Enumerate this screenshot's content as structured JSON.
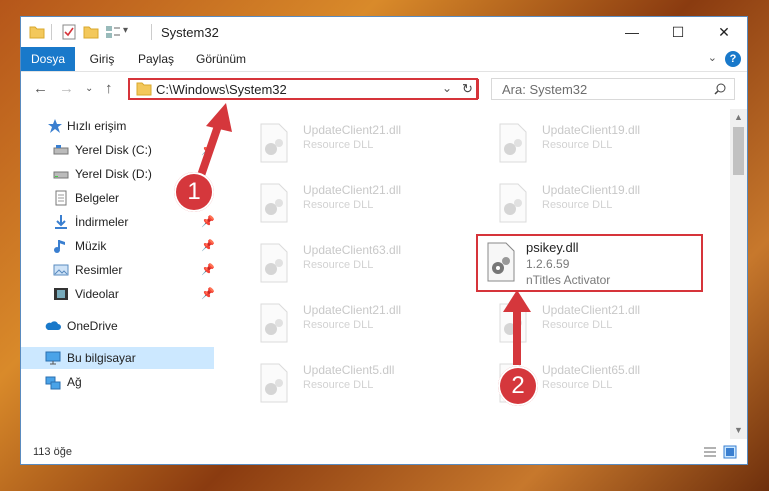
{
  "window": {
    "title": "System32",
    "controls": {
      "minimize": "—",
      "maximize": "☐",
      "close": "✕"
    }
  },
  "ribbon": {
    "tabs": [
      "Dosya",
      "Giriş",
      "Paylaş",
      "Görünüm"
    ],
    "help": "?"
  },
  "address": {
    "path": "C:\\Windows\\System32",
    "search_placeholder": "Ara: System32"
  },
  "sidebar": {
    "items": [
      {
        "label": "Hızlı erişim",
        "icon": "star-icon"
      },
      {
        "label": "Yerel Disk (C:)",
        "icon": "drive-icon",
        "pinned": true
      },
      {
        "label": "Yerel Disk (D:)",
        "icon": "drive-icon"
      },
      {
        "label": "Belgeler",
        "icon": "documents-icon"
      },
      {
        "label": "İndirmeler",
        "icon": "download-icon",
        "pinned": true
      },
      {
        "label": "Müzik",
        "icon": "music-icon",
        "pinned": true
      },
      {
        "label": "Resimler",
        "icon": "pictures-icon",
        "pinned": true
      },
      {
        "label": "Videolar",
        "icon": "videos-icon",
        "pinned": true
      },
      {
        "label": "OneDrive",
        "icon": "cloud-icon"
      },
      {
        "label": "Bu bilgisayar",
        "icon": "computer-icon",
        "selected": true
      },
      {
        "label": "Ağ",
        "icon": "network-icon"
      }
    ]
  },
  "files": [
    {
      "name": "UpdateClient21.dll",
      "desc": "Resource DLL"
    },
    {
      "name": "UpdateClient19.dll",
      "desc": "Resource DLL"
    },
    {
      "name": "UpdateClient21.dll",
      "desc": "Resource DLL"
    },
    {
      "name": "UpdateClient19.dll",
      "desc": "Resource DLL"
    },
    {
      "name": "UpdateClient63.dll",
      "desc": "Resource DLL"
    },
    {
      "name": "psikey.dll",
      "desc": "1.2.6.59",
      "desc2": "nTitles Activator"
    },
    {
      "name": "UpdateClient21.dll",
      "desc": "Resource DLL"
    },
    {
      "name": "UpdateClient21.dll",
      "desc": "Resource DLL"
    },
    {
      "name": "UpdateClient5.dll",
      "desc": "Resource DLL"
    },
    {
      "name": "UpdateClient65.dll",
      "desc": "Resource DLL"
    }
  ],
  "status": {
    "count": "113 öğe"
  },
  "annotations": {
    "step1": "1",
    "step2": "2"
  },
  "colors": {
    "accent": "#1979ca",
    "highlight": "#d6343a",
    "selected": "#cce8ff"
  }
}
